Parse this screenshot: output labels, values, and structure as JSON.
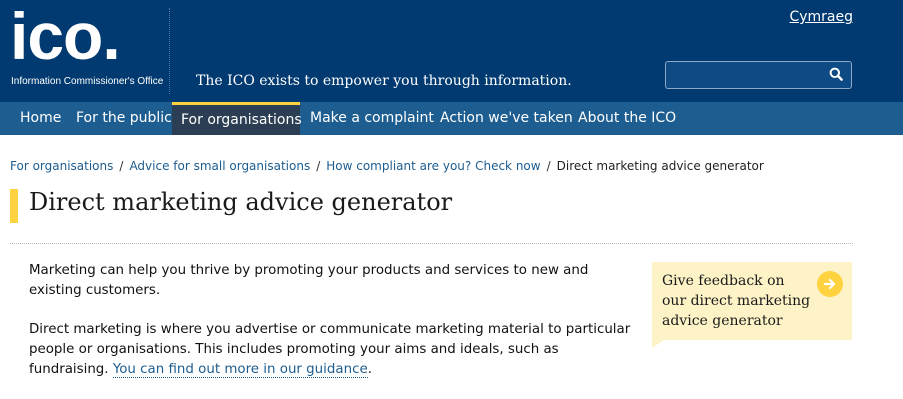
{
  "header": {
    "logo_text": "ico.",
    "logo_subtitle": "Information Commissioner's Office",
    "strapline": "The ICO exists to empower you through information.",
    "language_link": "Cymraeg",
    "search": {
      "placeholder": "",
      "icon": "search-icon"
    }
  },
  "nav": {
    "items": [
      {
        "label": "Home"
      },
      {
        "label": "For the public"
      },
      {
        "label": "For organisations",
        "active": true
      },
      {
        "label": "Make a complaint"
      },
      {
        "label": "Action we've taken"
      },
      {
        "label": "About the ICO"
      }
    ]
  },
  "breadcrumb": {
    "items": [
      "For organisations",
      "Advice for small organisations",
      "How compliant are you? Check now"
    ],
    "current": "Direct marketing advice generator",
    "separator": "/"
  },
  "page": {
    "title": "Direct marketing advice generator",
    "paragraph1": "Marketing can help you thrive by promoting your products and services to new and existing customers.",
    "paragraph2": "Direct marketing is where you advertise or communicate marketing material to particular people or organisations. This includes promoting your aims and ideals, such as fundraising. ",
    "paragraph2_link": "You can find out more in our guidance",
    "paragraph2_end": "."
  },
  "feedback": {
    "text": "Give feedback on our direct marketing advice generator",
    "icon": "arrow-right-icon"
  },
  "colors": {
    "header_bg": "#003a70",
    "nav_bg": "#1d5d90",
    "nav_active_bg": "#2c3e53",
    "accent_yellow": "#ffd23f",
    "feedback_bg": "#fdf3c7",
    "link": "#1d5d90"
  }
}
